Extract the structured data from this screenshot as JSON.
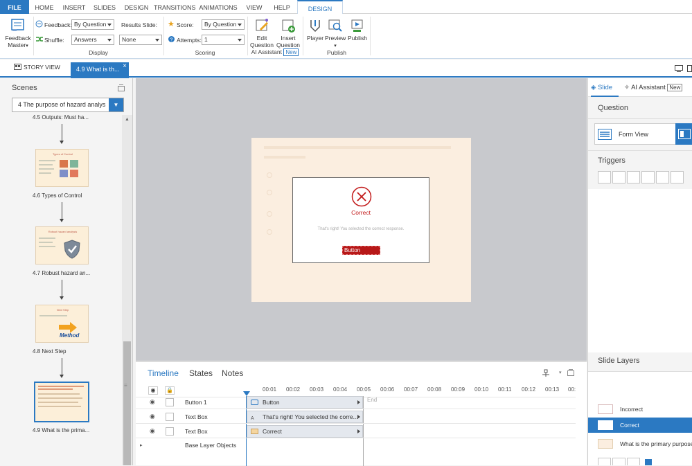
{
  "menu": {
    "tabs": [
      "FILE",
      "HOME",
      "INSERT",
      "SLIDES",
      "DESIGN",
      "TRANSITIONS",
      "ANIMATIONS",
      "VIEW",
      "HELP",
      "DESIGN"
    ]
  },
  "ribbon": {
    "feedback_master": "Feedback Master",
    "feedback_label": "Feedback:",
    "feedback_value": "By Question",
    "shuffle_label": "Shuffle:",
    "shuffle_value": "Answers",
    "results_label": "Results Slide:",
    "results_value": "None",
    "display_group": "Display",
    "score_label": "Score:",
    "score_value": "By Question",
    "attempts_label": "Attempts:",
    "attempts_value": "1",
    "scoring_group": "Scoring",
    "edit_question": "Edit Question",
    "insert_question": "Insert Question",
    "ai_assistant": "AI Assistant",
    "new_badge": "New",
    "player": "Player",
    "preview": "Preview",
    "publish": "Publish",
    "publish_group": "Publish"
  },
  "tabs": {
    "story_view": "STORY VIEW",
    "slide_tab": "4.9 What is th...",
    "close": "×"
  },
  "scenes": {
    "title": "Scenes",
    "selected_scene": "4 The purpose of hazard analys",
    "slides": [
      {
        "caption": "4.5 Outputs: Must ha..."
      },
      {
        "caption": "4.6 Types of Control",
        "thumb_title": "Types of Control"
      },
      {
        "caption": "4.7 Robust hazard an...",
        "thumb_title": "Robust hazard analysis"
      },
      {
        "caption": "4.8 Next Step",
        "thumb_title": "Next Step",
        "thumb_word": "Method"
      },
      {
        "caption": "4.9 What is the prima..."
      }
    ]
  },
  "dialog": {
    "title": "Correct",
    "message": "That's right!  You selected the correct response.",
    "button": "Button"
  },
  "timeline": {
    "tabs": [
      "Timeline",
      "States",
      "Notes"
    ],
    "ticks": [
      "00:01",
      "00:02",
      "00:03",
      "00:04",
      "00:05",
      "00:06",
      "00:07",
      "00:08",
      "00:09",
      "00:10",
      "00:11",
      "00:12",
      "00:13",
      "00:"
    ],
    "end_label": "End",
    "rows": [
      {
        "name": "Button 1",
        "bar": "Button"
      },
      {
        "name": "Text Box",
        "bar": "That's right! You selected the corre..."
      },
      {
        "name": "Text Box",
        "bar": "Correct"
      }
    ],
    "base_layer": "Base Layer Objects"
  },
  "right_panel": {
    "tab_slide": "Slide",
    "tab_ai": "AI Assistant",
    "new_badge": "New",
    "question_heading": "Question",
    "form_view": "Form View",
    "triggers_heading": "Triggers",
    "slide_layers_heading": "Slide Layers",
    "layers": [
      "Incorrect",
      "Correct",
      "What is the primary purpose"
    ]
  },
  "colors": {
    "accent": "#2b79c2",
    "correct_red": "#c21a1a"
  }
}
